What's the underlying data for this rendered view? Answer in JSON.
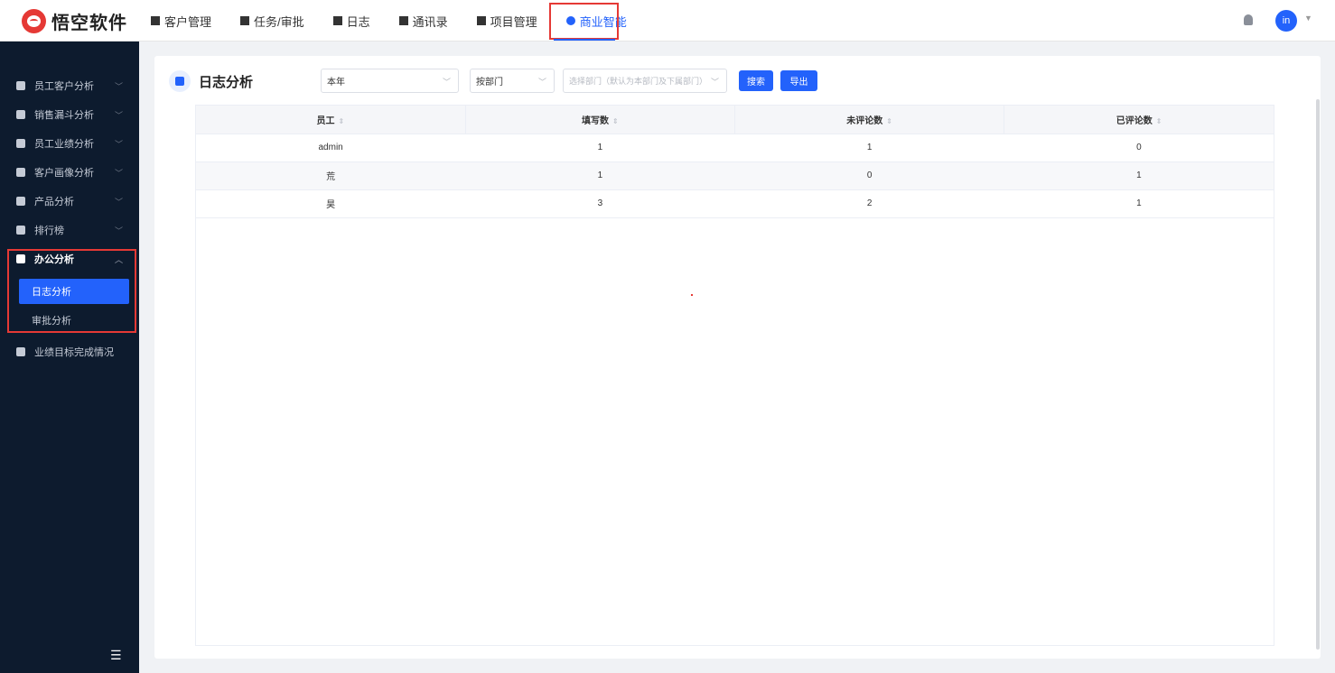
{
  "brand": {
    "name": "悟空软件"
  },
  "nav": {
    "items": [
      {
        "label": "客户管理",
        "icon": "building-icon"
      },
      {
        "label": "任务/审批",
        "icon": "briefcase-icon"
      },
      {
        "label": "日志",
        "icon": "note-icon"
      },
      {
        "label": "通讯录",
        "icon": "contacts-icon"
      },
      {
        "label": "项目管理",
        "icon": "list-icon"
      },
      {
        "label": "商业智能",
        "icon": "shield-check-icon",
        "active": true
      }
    ]
  },
  "user": {
    "avatar_text": "in"
  },
  "sidebar": {
    "items": [
      {
        "label": "员工客户分析",
        "icon": "person-icon"
      },
      {
        "label": "销售漏斗分析",
        "icon": "funnel-icon"
      },
      {
        "label": "员工业绩分析",
        "icon": "bar-chart-icon"
      },
      {
        "label": "客户画像分析",
        "icon": "users-icon"
      },
      {
        "label": "产品分析",
        "icon": "box-icon"
      },
      {
        "label": "排行榜",
        "icon": "trophy-icon"
      },
      {
        "label": "办公分析",
        "icon": "briefcase-icon",
        "open": true
      },
      {
        "label": "业绩目标完成情况",
        "icon": "target-icon"
      }
    ],
    "sub_items": [
      {
        "label": "日志分析",
        "active": true
      },
      {
        "label": "审批分析"
      }
    ]
  },
  "page": {
    "title": "日志分析",
    "filters": {
      "period": "本年",
      "group_by": "按部门",
      "dept_placeholder": "选择部门（默认为本部门及下属部门）"
    },
    "buttons": {
      "search": "搜索",
      "export": "导出"
    }
  },
  "table": {
    "columns": [
      "员工",
      "填写数",
      "未评论数",
      "已评论数"
    ],
    "rows": [
      [
        "admin",
        "1",
        "1",
        "0"
      ],
      [
        "荒",
        "1",
        "0",
        "1"
      ],
      [
        "昊",
        "3",
        "2",
        "1"
      ]
    ]
  },
  "colors": {
    "accent": "#2362fb",
    "highlight": "#e53935",
    "sidebar_bg": "#0d1b2e"
  }
}
